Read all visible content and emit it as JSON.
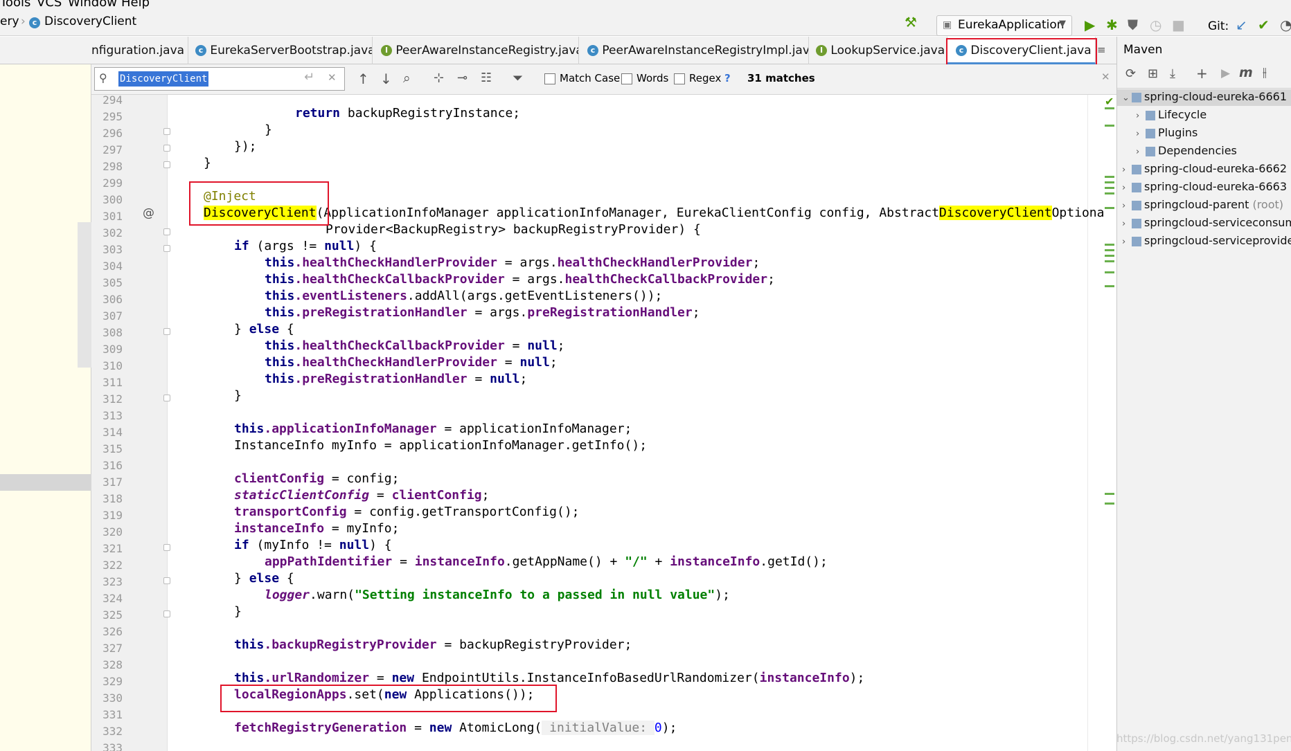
{
  "menu": {
    "tools": "Tools",
    "vcs": "VCS",
    "window": "Window",
    "help": "Help"
  },
  "breadcrumb": {
    "prev": "ery",
    "current": "DiscoveryClient"
  },
  "run_config": {
    "label": "EurekaApplication"
  },
  "git_label": "Git:",
  "tabs": [
    {
      "label": "nfiguration.java"
    },
    {
      "label": "EurekaServerBootstrap.java"
    },
    {
      "label": "PeerAwareInstanceRegistry.java"
    },
    {
      "label": "PeerAwareInstanceRegistryImpl.java"
    },
    {
      "label": "LookupService.java"
    },
    {
      "label": "DiscoveryClient.java"
    }
  ],
  "search": {
    "value": "DiscoveryClient",
    "match_case": "Match Case",
    "words": "Words",
    "regex": "Regex",
    "help": "?",
    "matches": "31 matches"
  },
  "maven": {
    "title": "Maven",
    "items": [
      {
        "label": "spring-cloud-eureka-6661"
      },
      {
        "label": "Lifecycle"
      },
      {
        "label": "Plugins"
      },
      {
        "label": "Dependencies"
      },
      {
        "label": "spring-cloud-eureka-6662"
      },
      {
        "label": "spring-cloud-eureka-6663"
      },
      {
        "label": "springcloud-parent",
        "suffix": "(root)"
      },
      {
        "label": "springcloud-serviceconsum"
      },
      {
        "label": "springcloud-serviceprovide"
      }
    ]
  },
  "line_numbers": [
    "294",
    "295",
    "296",
    "297",
    "298",
    "299",
    "300",
    "301",
    "302",
    "303",
    "304",
    "305",
    "306",
    "307",
    "308",
    "309",
    "310",
    "311",
    "312",
    "313",
    "314",
    "315",
    "316",
    "317",
    "318",
    "319",
    "320",
    "321",
    "322",
    "323",
    "324",
    "325",
    "326",
    "327",
    "328",
    "329",
    "330",
    "331",
    "332",
    "333"
  ],
  "code": {
    "l295_kw": "return",
    "l295_rest": " backupRegistryInstance;",
    "l296": "}",
    "l297": "});",
    "l298": "}",
    "l300": "@Inject",
    "l301_hl": "DiscoveryClient",
    "l301_mid": "(ApplicationInfoManager applicationInfoManager, EurekaClientConfig config, Abstract",
    "l301_hl2": "DiscoveryClient",
    "l301_end": "Optiona",
    "l302": "Provider<BackupRegistry> backupRegistryProvider) {",
    "l303_kw": "if",
    "l303_a": " (args != ",
    "l303_null": "null",
    "l303_b": ") {",
    "this": "this",
    "l304_f": ".healthCheckHandlerProvider",
    "l304_m": " = args.",
    "l304_f2": "healthCheckHandlerProvider",
    "l304_e": ";",
    "l305_f": ".healthCheckCallbackProvider",
    "l305_f2": "healthCheckCallbackProvider",
    "l306_f": ".eventListeners",
    "l306_m": ".addAll(args.getEventListeners());",
    "l307_f": ".preRegistrationHandler",
    "l307_f2": "preRegistrationHandler",
    "l308_a": "} ",
    "l308_kw": "else",
    "l308_b": " {",
    "l309_f": ".healthCheckCallbackProvider",
    "eq": " = ",
    "null": "null",
    "semi": ";",
    "l310_f": ".healthCheckHandlerProvider",
    "l311_f": ".preRegistrationHandler",
    "l312": "}",
    "l314_f": ".applicationInfoManager",
    "l314_m": " = applicationInfoManager;",
    "l315": "InstanceInfo myInfo = applicationInfoManager.getInfo();",
    "l317_f": "clientConfig",
    "l317_m": " = config;",
    "l318_f": "staticClientConfig",
    "l318_f2": "clientConfig",
    "l319_f": "transportConfig",
    "l319_m": " = config.getTransportConfig();",
    "l320_f": "instanceInfo",
    "l320_m": " = myInfo;",
    "l321_kw": "if",
    "l321_a": " (myInfo != ",
    "l321_b": ") {",
    "l322_f": "appPathIdentifier",
    "l322_f2": "instanceInfo",
    "l322_m": ".getAppName() + ",
    "l322_s": "\"/\"",
    "l322_p": " + ",
    "l322_e": ".getId();",
    "l324_f": "logger",
    "l324_m": ".warn(",
    "l324_s": "\"Setting instanceInfo to a passed in null value\"",
    "l324_e": ");",
    "l325": "}",
    "l327_f": ".backupRegistryProvider",
    "l327_m": " = backupRegistryProvider;",
    "l329_f": ".urlRandomizer",
    "l329_kw": "new",
    "l329_m": " EndpointUtils.InstanceInfoBasedUrlRandomizer(",
    "l329_f2": "instanceInfo",
    "l329_e": ");",
    "l330_f": "localRegionApps",
    "l330_m": ".set(",
    "l330_kw": "new",
    "l330_e": " Applications());",
    "l332_f": "fetchRegistryGeneration",
    "l332_kw": "new",
    "l332_m": " AtomicLong(",
    "l332_hint": " initialValue: ",
    "l332_zero": "0",
    "l332_e": ");"
  },
  "gutter_marker": "@",
  "watermark": "https://blog.csdn.net/yang131peng"
}
